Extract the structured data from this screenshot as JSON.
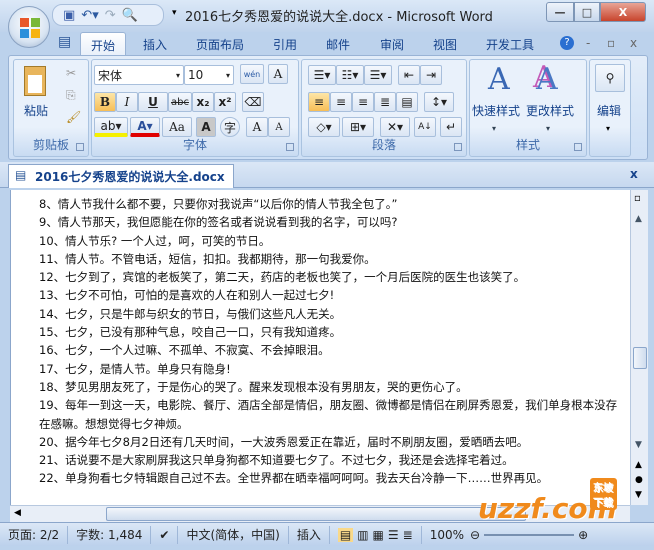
{
  "window": {
    "title": "2016七夕秀恩爱的说说大全.docx - Microsoft Word"
  },
  "tabs": [
    "开始",
    "插入",
    "页面布局",
    "引用",
    "邮件",
    "审阅",
    "视图",
    "开发工具"
  ],
  "ribbon": {
    "clipboard": {
      "label": "剪贴板",
      "paste": "粘贴"
    },
    "font": {
      "label": "字体",
      "font_name": "宋体",
      "font_size": "10",
      "bold": "B",
      "italic": "I",
      "underline": "U",
      "strike": "abc",
      "subscript": "x₂",
      "superscript": "x²",
      "change_case": "Aa",
      "grow": "A",
      "shrink": "A",
      "wen": "wén",
      "char_border": "A",
      "char_shade": "A",
      "enclose": "字"
    },
    "paragraph": {
      "label": "段落"
    },
    "styles": {
      "label": "样式",
      "quick": "快速样式",
      "change": "更改样式"
    },
    "editing": {
      "label": "编辑"
    }
  },
  "document": {
    "tab_title": "2016七夕秀恩爱的说说大全.docx",
    "lines": [
      "8、情人节我什么都不要，只要你对我说声“以后你的情人节我全包了。”",
      "9、情人节那天，我但愿能在你的签名或者说说看到我的名字，可以吗?",
      "10、情人节乐? 一个人过，呵，可笑的节日。",
      "11、情人节。不管电话，短信，扣扣。我都期待，那一句我爱你。",
      "12、七夕到了，宾馆的老板笑了，第二天，药店的老板也笑了，一个月后医院的医生也该笑了。",
      "13、七夕不可怕，可怕的是喜欢的人在和别人一起过七夕!",
      "14、七夕，只是牛郎与织女的节日，与俄们这些凡人无关。",
      "15、七夕，已没有那种气息，咬自己一口，只有我知道疼。",
      "16、七夕，一个人过嘛、不孤单、不寂寞、不会掉眼泪。",
      "17、七夕，是情人节。单身只有隐身!",
      "18、梦见男朋友死了，于是伤心的哭了。醒来发现根本没有男朋友，哭的更伤心了。",
      "19、每年一到这一天，电影院、餐厅、酒店全部是情侣，朋友圈、微博都是情侣在刷屏秀恩爱，我们单身根本没存在感嘛。想想觉得七夕神烦。",
      "20、据今年七夕8月2日还有几天时间，一大波秀恩爱正在靠近，届时不刷朋友圈，爱晒晒去吧。",
      "21、话说要不是大家刷屏我这只单身狗都不知道要七夕了。不过七夕，我还是会选择宅着过。",
      "22、单身狗看七夕特辑跟自己过不去。全世界都在晒幸福呵呵呵。我去天台冷静一下……世界再见。"
    ]
  },
  "status": {
    "page": "页面: 2/2",
    "words": "字数: 1,484",
    "language": "中文(简体，中国)",
    "mode": "插入",
    "zoom": "100%"
  },
  "watermark": {
    "text": "uzzf.com",
    "sub": "东坡下载"
  }
}
